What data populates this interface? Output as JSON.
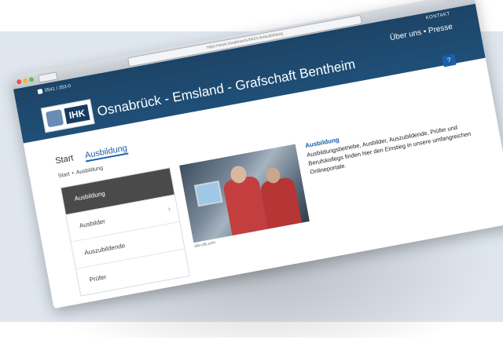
{
  "browser": {
    "url": "https://www.osnabrueck.ihk24.de/ausbildung"
  },
  "header": {
    "phone": "0541 / 353-0",
    "kontakt": "KONTAKT",
    "topnav": "Über uns • Presse",
    "logo_text": "IHK",
    "site_title": "Osnabrück - Emsland - Grafschaft Bentheim",
    "help_label": "?"
  },
  "tabs": [
    {
      "label": "Start"
    },
    {
      "label": "Ausbildung"
    }
  ],
  "breadcrumb": {
    "home": "Start",
    "separator": "•",
    "current": "Ausbildung"
  },
  "sidebar": {
    "items": [
      {
        "label": "Ausbildung"
      },
      {
        "label": "Ausbilder"
      },
      {
        "label": "Auszubildende"
      },
      {
        "label": "Prüfer"
      }
    ]
  },
  "teaser": {
    "credit": "ddr.cdb.com",
    "title": "Ausbildung",
    "text": "Ausbildungsbetriebe, Ausbilder, Auszubildende, Prüfer und Berufskollegs finden hier den Einstieg in unsere umfangreichen Onlineportale."
  },
  "colors": {
    "header_bg": "#1f4f78",
    "accent": "#1b5fa8",
    "sidebar_active": "#4a4a4a"
  }
}
